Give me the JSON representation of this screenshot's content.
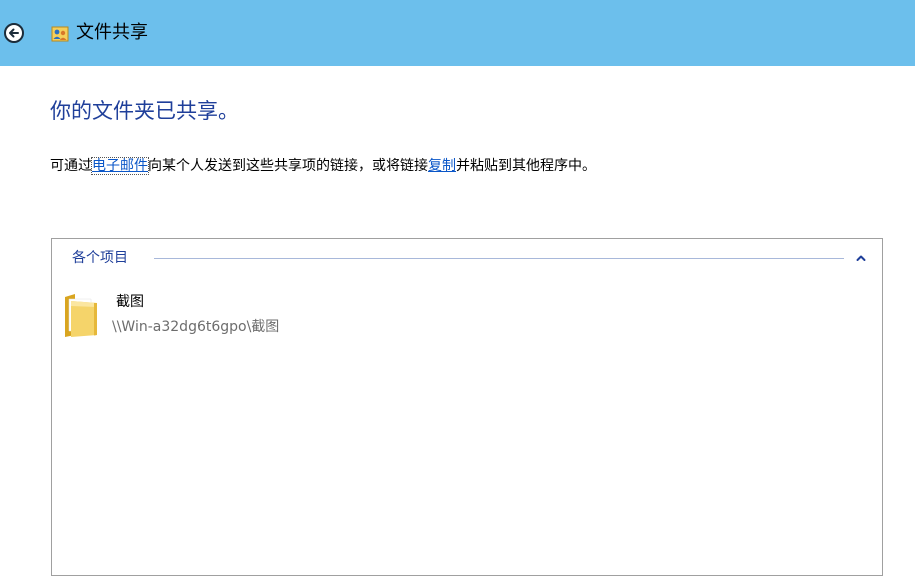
{
  "window": {
    "title": "文件共享",
    "back_icon": "back-arrow-icon",
    "app_icon": "file-sharing-icon",
    "colors": {
      "titlebar": "#6cbfec",
      "heading": "#1f3f9a",
      "link": "#0a56c8"
    }
  },
  "main": {
    "heading": "你的文件夹已共享。",
    "description": {
      "prefix": "可通过",
      "email_link": "电子邮件",
      "middle": "向某个人发送到这些共享项的链接，或将链接",
      "copy_link": "复制",
      "suffix": "并粘贴到其他程序中。"
    }
  },
  "items_group": {
    "label": "各个项目",
    "chevron_icon": "chevron-up-icon",
    "items": [
      {
        "name": "截图",
        "path": "\\\\Win-a32dg6t6gpo\\截图",
        "icon": "folder-icon"
      }
    ]
  }
}
